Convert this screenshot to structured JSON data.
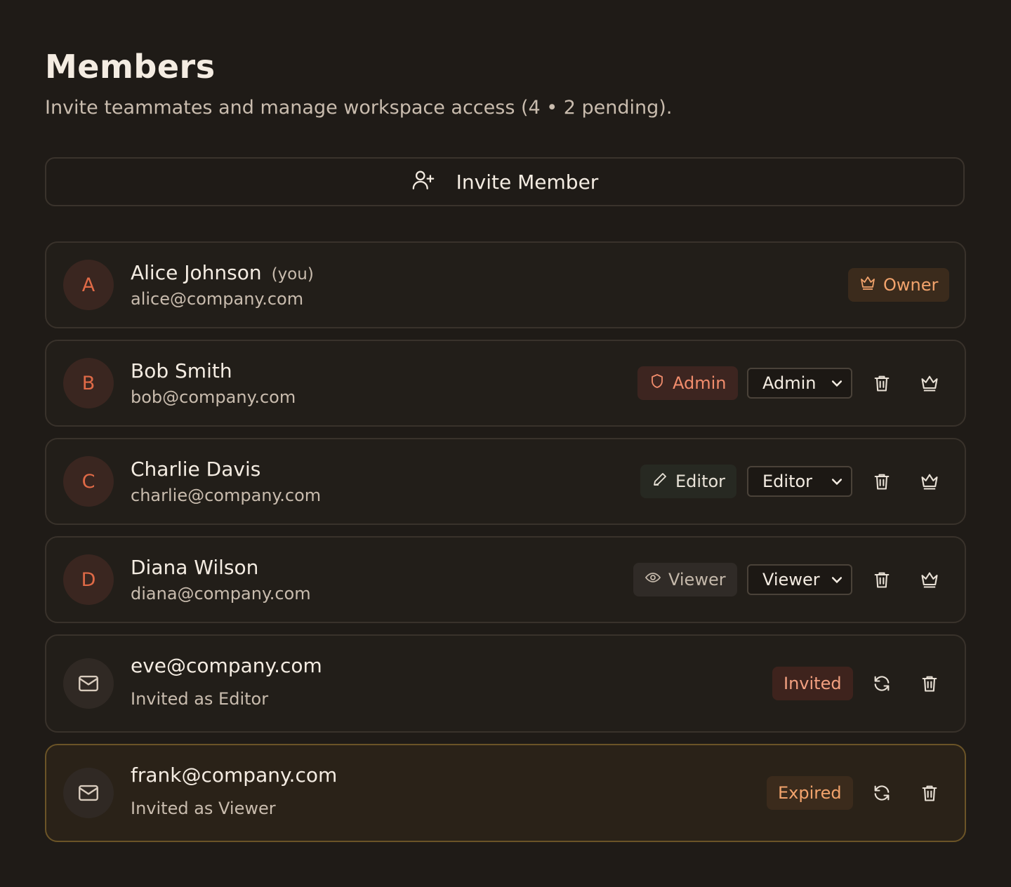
{
  "header": {
    "title": "Members",
    "subtitle": "Invite teammates and manage workspace access (4 • 2 pending)."
  },
  "invite_button": {
    "label": "Invite Member",
    "icon": "user-plus-icon"
  },
  "members": [
    {
      "initial": "A",
      "name": "Alice Johnson",
      "you_label": "(you)",
      "email": "alice@company.com",
      "role_badge": "Owner"
    },
    {
      "initial": "B",
      "name": "Bob Smith",
      "email": "bob@company.com",
      "role_badge": "Admin",
      "role_select": "Admin"
    },
    {
      "initial": "C",
      "name": "Charlie Davis",
      "email": "charlie@company.com",
      "role_badge": "Editor",
      "role_select": "Editor"
    },
    {
      "initial": "D",
      "name": "Diana Wilson",
      "email": "diana@company.com",
      "role_badge": "Viewer",
      "role_select": "Viewer"
    }
  ],
  "invites": [
    {
      "email": "eve@company.com",
      "role_text": "Invited as Editor",
      "status": "Invited"
    },
    {
      "email": "frank@company.com",
      "role_text": "Invited as Viewer",
      "status": "Expired"
    }
  ],
  "colors": {
    "background": "#1f1b17",
    "card": "#221e19",
    "accent_orange": "#e06a47",
    "owner_badge": "#f2a36c",
    "expired_border": "#6b5427"
  }
}
